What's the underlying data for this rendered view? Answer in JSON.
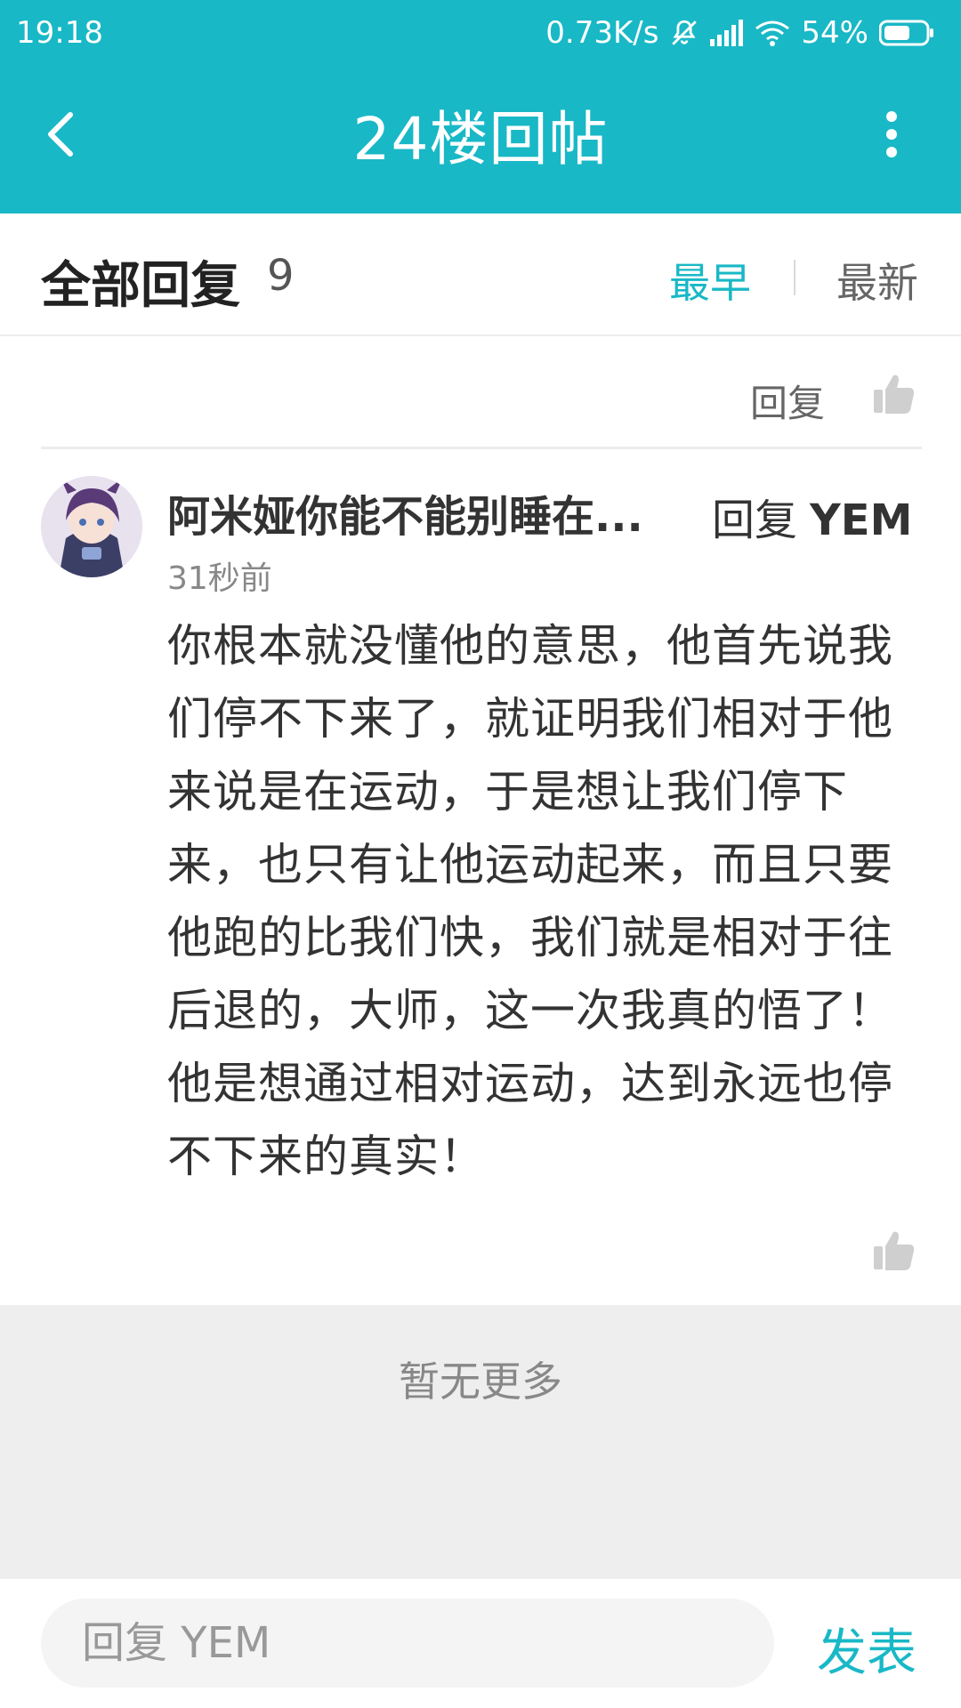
{
  "status_bar": {
    "time": "19:18",
    "network_speed": "0.73K/s",
    "battery": "54%",
    "icons": [
      "mute-bell-icon",
      "signal-icon",
      "wifi-icon",
      "battery-icon"
    ]
  },
  "app_bar": {
    "title": "24楼回帖",
    "back_icon": "chevron-left-icon",
    "more_icon": "more-vertical-icon"
  },
  "replies_header": {
    "title": "全部回复",
    "count": "9",
    "sort_earliest": "最早",
    "sort_latest": "最新"
  },
  "post_actions": {
    "reply_label": "回复",
    "like_icon": "thumbs-up-icon"
  },
  "comment": {
    "author": "阿米娅你能不能别睡在...",
    "reply_label": "回复",
    "reply_target": "YEM",
    "time": "31秒前",
    "body": "你根本就没懂他的意思，他首先说我们停不下来了，就证明我们相对于他来说是在运动，于是想让我们停下来，也只有让他运动起来，而且只要他跑的比我们快，我们就是相对于往后退的，大师，这一次我真的悟了！他是想通过相对运动，达到永远也停不下来的真实！",
    "like_icon": "thumbs-up-icon"
  },
  "footer": {
    "no_more": "暂无更多"
  },
  "input_bar": {
    "placeholder": "回复 YEM",
    "send_label": "发表"
  },
  "colors": {
    "accent": "#19B8C6",
    "text": "#333333",
    "muted": "#888888",
    "footer_bg": "#EEEEEE"
  }
}
